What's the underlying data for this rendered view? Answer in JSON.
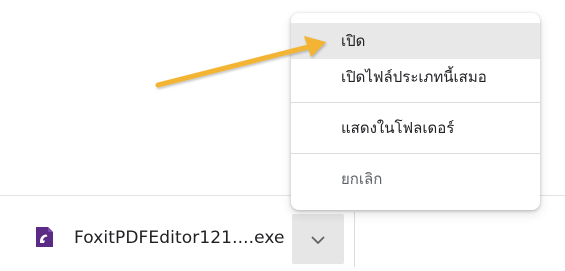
{
  "download_item": {
    "file_name": "FoxitPDFEditor121....exe",
    "icon": "foxit-pdf-icon",
    "chevron_icon": "chevron-down-icon"
  },
  "context_menu": {
    "items": [
      {
        "label": "เปิด",
        "state": "highlighted"
      },
      {
        "label": "เปิดไฟล์ประเภทนี้เสมอ",
        "state": "normal"
      },
      {
        "label": "แสดงในโฟลเดอร์",
        "state": "normal"
      },
      {
        "label": "ยกเลิก",
        "state": "normal"
      }
    ]
  },
  "annotation": {
    "arrow_color": "#f2b431",
    "icon": "pointer-arrow"
  },
  "colors": {
    "menu_highlight": "#e8e8e8",
    "foxit_brand": "#5b2a86"
  }
}
